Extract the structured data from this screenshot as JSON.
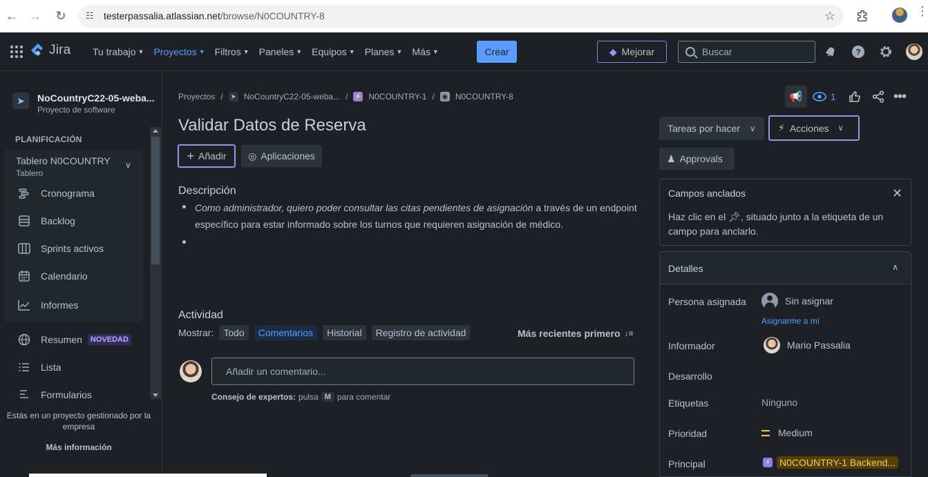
{
  "browser": {
    "url_host": "testerpassalia.atlassian.net",
    "url_path": "/browse/N0COUNTRY-8"
  },
  "topnav": {
    "logo": "Jira",
    "menu": [
      {
        "label": "Tu trabajo",
        "active": false
      },
      {
        "label": "Proyectos",
        "active": true
      },
      {
        "label": "Filtros",
        "active": false
      },
      {
        "label": "Paneles",
        "active": false
      },
      {
        "label": "Equipos",
        "active": false
      },
      {
        "label": "Planes",
        "active": false
      },
      {
        "label": "Más",
        "active": false
      }
    ],
    "create_label": "Crear",
    "upgrade_label": "Mejorar",
    "search_placeholder": "Buscar"
  },
  "sidebar": {
    "project_name": "NoCountryC22-05-weba...",
    "project_type": "Proyecto de software",
    "planning_heading": "PLANIFICACIÓN",
    "board_title": "Tablero N0COUNTRY",
    "board_subtitle": "Tablero",
    "items": [
      {
        "label": "Cronograma",
        "icon": "timeline-icon"
      },
      {
        "label": "Backlog",
        "icon": "backlog-icon"
      },
      {
        "label": "Sprints activos",
        "icon": "board-icon"
      },
      {
        "label": "Calendario",
        "icon": "calendar-icon"
      },
      {
        "label": "Informes",
        "icon": "reports-icon"
      }
    ],
    "summary_label": "Resumen",
    "new_badge": "NOVEDAD",
    "list_label": "Lista",
    "forms_label": "Formularios",
    "footer_text": "Estás en un proyecto gestionado por la empresa",
    "more_info": "Más información"
  },
  "breadcrumbs": {
    "root": "Proyectos",
    "project": "NoCountryC22-05-weba...",
    "parent": "N0COUNTRY-1",
    "current": "N0COUNTRY-8",
    "sep": "/"
  },
  "issue": {
    "title": "Validar Datos de Reserva",
    "add_label": "Añadir",
    "apps_label": "Aplicaciones",
    "description_heading": "Descripción",
    "description_italic": "Como administrador, quiero poder consultar las citas pendientes de asignación",
    "description_rest": " a través de un endpoint específico para estar informado sobre los turnos que requieren asignación de médico.",
    "watchers_count": "1"
  },
  "activity": {
    "heading": "Actividad",
    "show_label": "Mostrar:",
    "filters": [
      {
        "label": "Todo",
        "selected": false
      },
      {
        "label": "Comentarios",
        "selected": true
      },
      {
        "label": "Historial",
        "selected": false
      },
      {
        "label": "Registro de actividad",
        "selected": false
      }
    ],
    "sort_label": "Más recientes primero",
    "comment_placeholder": "Añadir un comentario...",
    "tip_bold": "Consejo de expertos:",
    "tip_press": "pulsa",
    "tip_key": "M",
    "tip_rest": "para comentar"
  },
  "right_panel": {
    "status_label": "Tareas por hacer",
    "actions_label": "Acciones",
    "approvals_label": "Approvals",
    "pinned_heading": "Campos anclados",
    "pinned_text_before": "Haz clic en el ",
    "pinned_text_after": ", situado junto a la etiqueta de un campo para anclarlo.",
    "details_heading": "Detalles",
    "fields": {
      "assignee_label": "Persona asignada",
      "assignee_value": "Sin asignar",
      "assign_me": "Asignarme a mí",
      "reporter_label": "Informador",
      "reporter_value": "Mario Passalia",
      "development_label": "Desarrollo",
      "labels_label": "Etiquetas",
      "labels_value": "Ninguno",
      "priority_label": "Prioridad",
      "priority_value": "Medium",
      "parent_label": "Principal",
      "parent_value": "N0COUNTRY-1 Backend..."
    }
  },
  "colors": {
    "accent": "#579dff",
    "purple": "#9f8fef",
    "background": "#1d2125",
    "priority_medium": "#f5cd47"
  }
}
